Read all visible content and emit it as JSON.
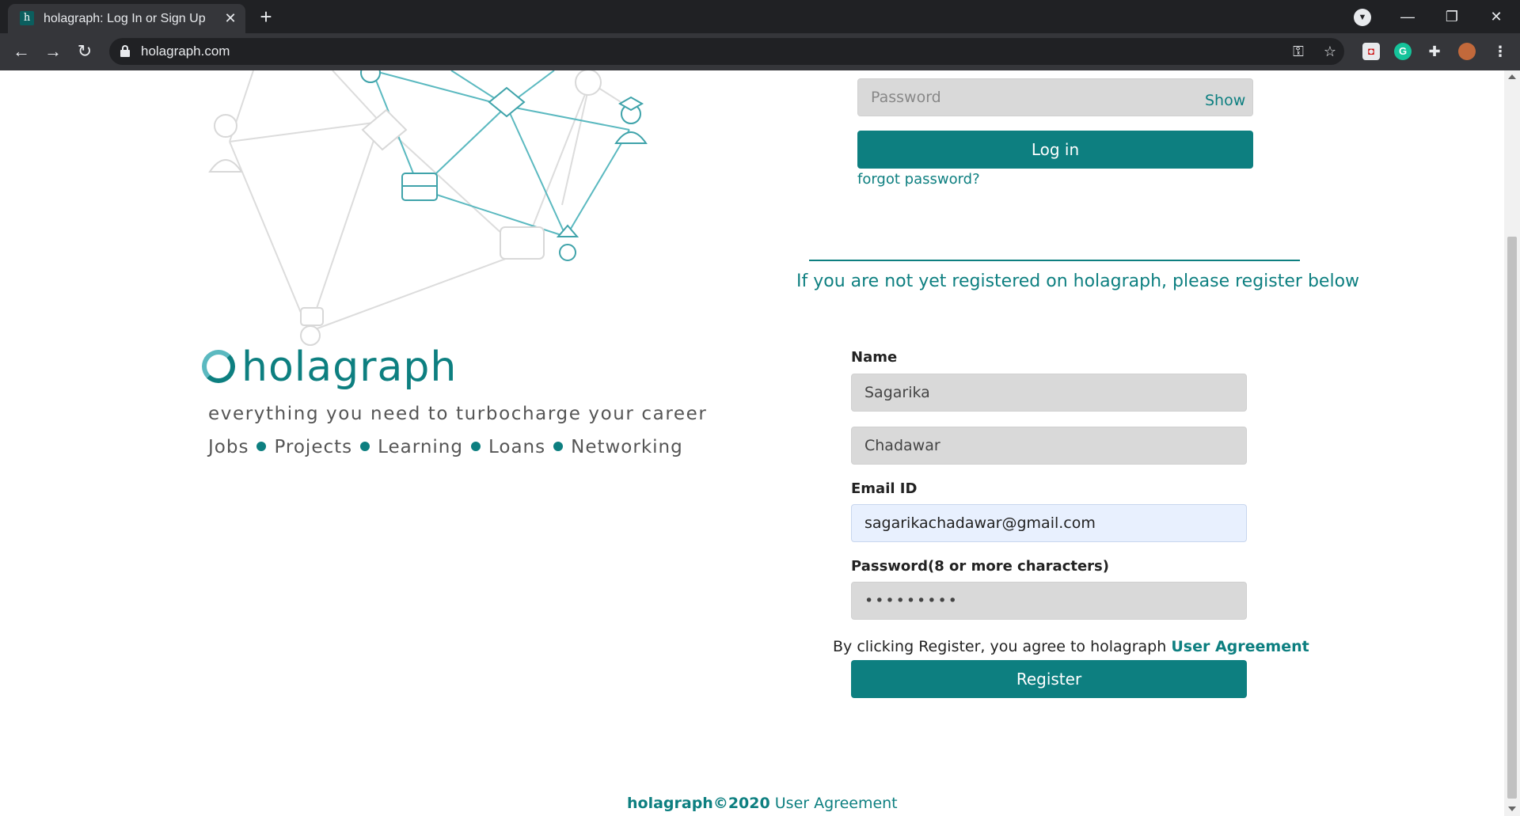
{
  "browser": {
    "tab_favicon": "h",
    "tab_title": "holagraph: Log In or Sign Up",
    "url": "holagraph.com",
    "icons": [
      "back-arrow-icon",
      "forward-arrow-icon",
      "reload-icon",
      "lock-icon",
      "key-icon",
      "star-icon",
      "extensions-icon"
    ]
  },
  "brand": {
    "name": "holagraph",
    "tagline": "everything you need to turbocharge your career",
    "features": [
      "Jobs",
      "Projects",
      "Learning",
      "Loans",
      "Networking"
    ],
    "accent_color": "#0d7f80"
  },
  "login": {
    "password_placeholder": "Password",
    "show_label": "Show",
    "login_button": "Log in",
    "forgot_password": "forgot password?"
  },
  "register": {
    "note": "If you are not yet registered on holagraph, please register below",
    "name_label": "Name",
    "first_name": "Sagarika",
    "last_name": "Chadawar",
    "email_label": "Email ID",
    "email": "sagarikachadawar@gmail.com",
    "password_label": "Password(8 or more characters)",
    "password_masked": "•••••••••",
    "agreement_text": "By clicking Register, you agree to holagraph",
    "agreement_link": "User Agreement",
    "register_button": "Register"
  },
  "footer": {
    "brand": "holagraph©2020",
    "link": "User Agreement"
  }
}
